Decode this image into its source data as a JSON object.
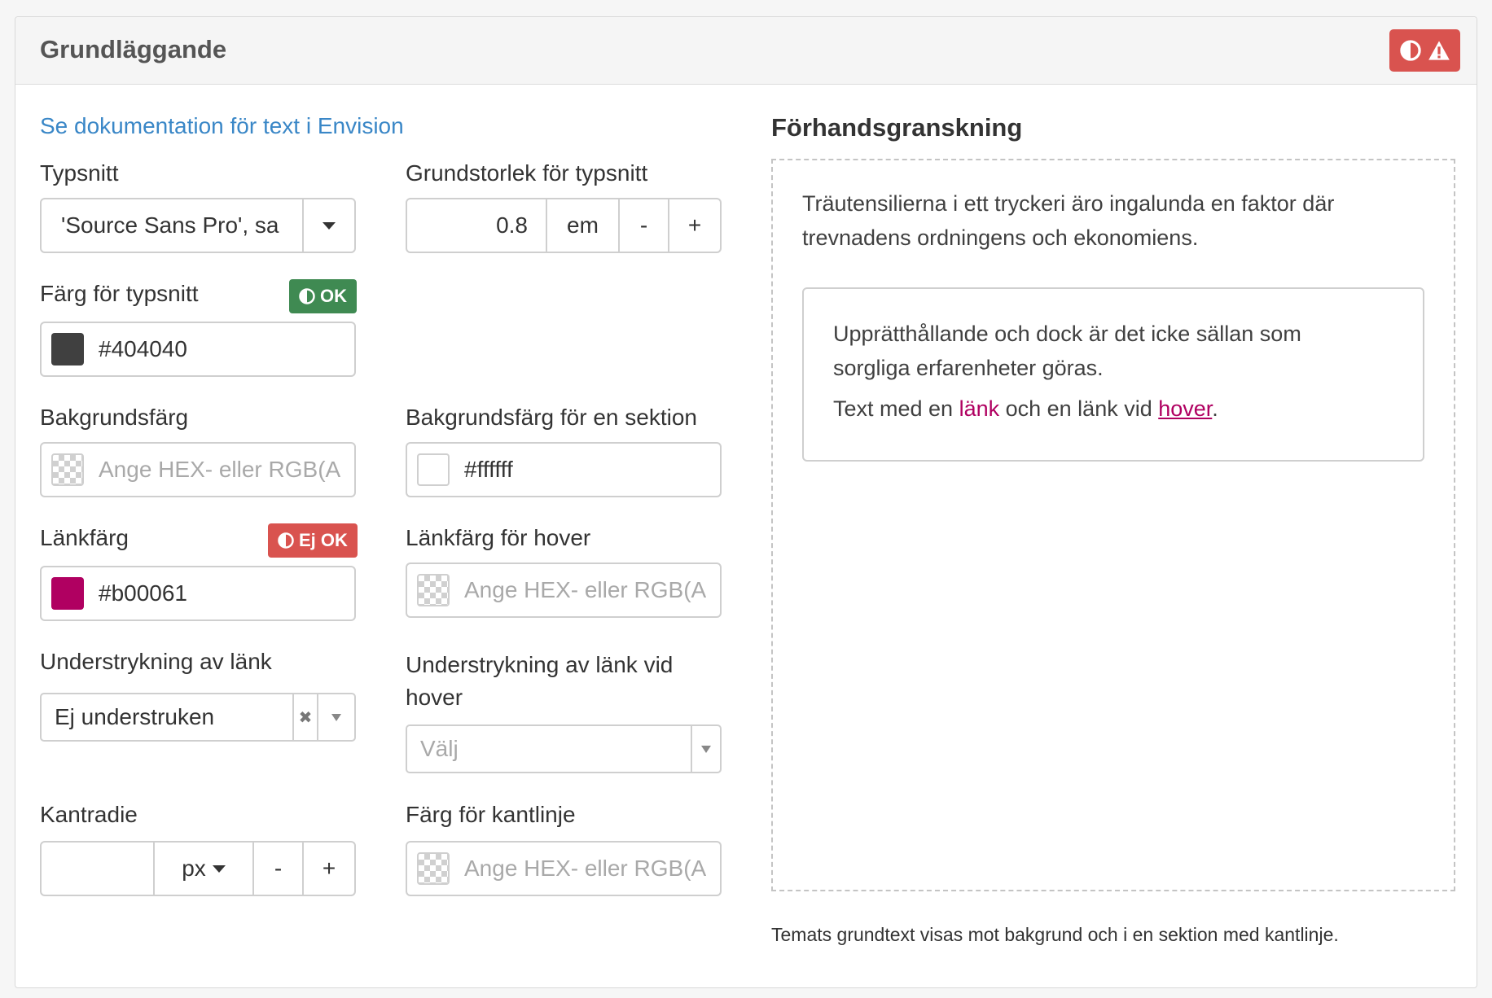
{
  "panel": {
    "title": "Grundläggande",
    "alert_icons": [
      "contrast-icon",
      "warning-icon"
    ]
  },
  "doc_link": "Se dokumentation för text i Envision",
  "font_family": {
    "label": "Typsnitt",
    "value": "'Source Sans Pro', sa"
  },
  "base_size": {
    "label": "Grundstorlek för typsnitt",
    "value": "0.8",
    "unit": "em",
    "minus": "-",
    "plus": "+"
  },
  "font_color": {
    "label": "Färg för typsnitt",
    "status": "OK",
    "value": "#404040",
    "swatch": "#404040"
  },
  "background_color": {
    "label": "Bakgrundsfärg",
    "placeholder": "Ange HEX- eller RGB(A"
  },
  "section_background": {
    "label": "Bakgrundsfärg för en sektion",
    "value": "#ffffff",
    "swatch": "#ffffff"
  },
  "link_color": {
    "label": "Länkfärg",
    "status": "Ej OK",
    "value": "#b00061",
    "swatch": "#b00061"
  },
  "link_hover_color": {
    "label": "Länkfärg för hover",
    "placeholder": "Ange HEX- eller RGB(A"
  },
  "link_underline": {
    "label": "Understrykning av länk",
    "value": "Ej understruken",
    "clear": "✖"
  },
  "link_hover_underline": {
    "label_line1": "Understrykning av länk vid",
    "label_line2": "hover",
    "placeholder": "Välj"
  },
  "border_radius": {
    "label": "Kantradie",
    "value": "",
    "unit": "px",
    "minus": "-",
    "plus": "+"
  },
  "border_color": {
    "label": "Färg för kantlinje",
    "placeholder": "Ange HEX- eller RGB(A"
  },
  "preview": {
    "title": "Förhandsgranskning",
    "paragraph_line1": "Träutensilierna i ett tryckeri äro ingalunda en faktor där",
    "paragraph_line2": "trevnadens ordningens och ekonomiens.",
    "section_line1": "Upprätthållande och dock är det icke sällan som",
    "section_line2": "sorgliga erfarenheter göras.",
    "link_text_before": "Text med en ",
    "link_word": "länk",
    "link_text_middle": " och en länk vid ",
    "hover_word": "hover",
    "link_text_after": "."
  },
  "footnote": "Temats grundtext visas mot bakgrund och i en sektion med kantlinje.",
  "colors": {
    "ok": "#3f8a52",
    "not_ok": "#d9534f",
    "link": "#3a87c7",
    "preview_link": "#b00061"
  }
}
